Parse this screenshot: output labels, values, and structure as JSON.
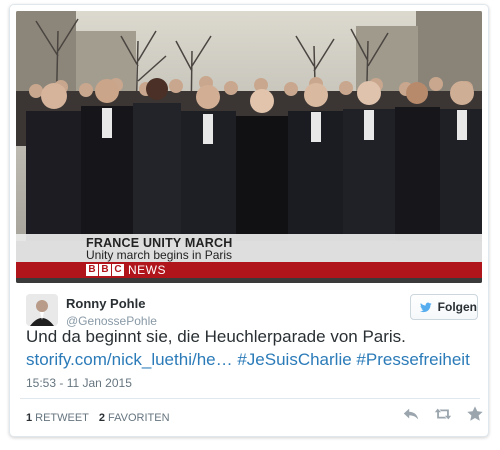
{
  "news_overlay": {
    "headline": "FRANCE UNITY MARCH",
    "subline": "Unity march begins in Paris",
    "logo_letters": [
      "B",
      "B",
      "C"
    ],
    "channel_word": "NEWS",
    "brand_color": "#b1151c"
  },
  "tweet": {
    "author_name": "Ronny Pohle",
    "author_handle": "@GenossePohle",
    "follow_label": "Folgen",
    "text": "Und da beginnt sie, die Heuchlerparade von Paris.",
    "link_url": "storify.com/nick_luethi/he…",
    "hashtags": [
      "#JeSuisCharlie",
      "#Pressefreiheit"
    ],
    "timestamp": "15:53 - 11 Jan 2015",
    "retweet_count": "1",
    "retweet_label": "RETWEET",
    "favorite_count": "2",
    "favorite_label": "FAVORITEN",
    "link_color": "#2b7bb9"
  },
  "icons": {
    "follow": "twitter-bird-icon",
    "reply": "reply-icon",
    "retweet": "retweet-icon",
    "favorite": "star-icon"
  }
}
